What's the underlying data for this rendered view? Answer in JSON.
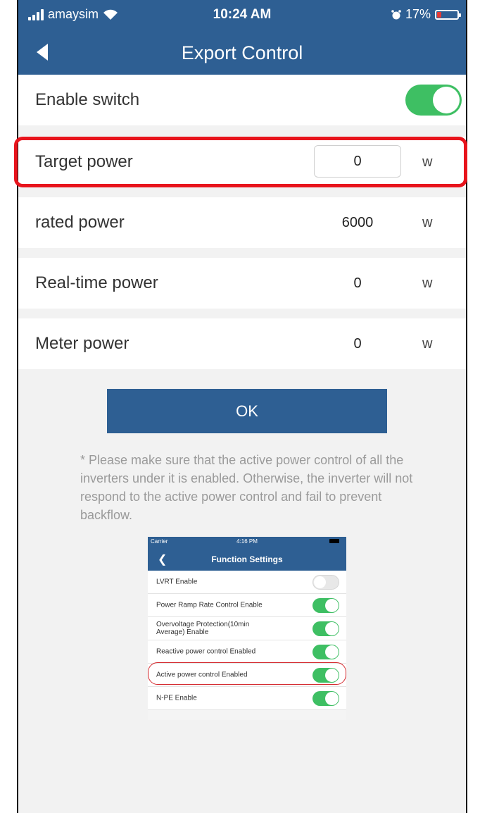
{
  "status_bar": {
    "carrier": "amaysim",
    "time": "10:24 AM",
    "battery": "17%"
  },
  "nav": {
    "title": "Export Control"
  },
  "rows": {
    "enable_switch": {
      "label": "Enable switch",
      "enabled": true
    },
    "target_power": {
      "label": "Target power",
      "value": "0",
      "unit": "w"
    },
    "rated_power": {
      "label": "rated power",
      "value": "6000",
      "unit": "w"
    },
    "realtime_power": {
      "label": "Real-time power",
      "value": "0",
      "unit": "w"
    },
    "meter_power": {
      "label": "Meter power",
      "value": "0",
      "unit": "w"
    }
  },
  "ok_button": {
    "label": "OK"
  },
  "note": "* Please make sure that the active power control of all the inverters under it is enabled. Otherwise, the inverter will not respond to the active power control and fail to prevent backflow.",
  "inset": {
    "status_bar": {
      "carrier": "Carrier",
      "time": "4:16 PM"
    },
    "title": "Function Settings",
    "items": [
      {
        "label": "LVRT Enable",
        "enabled": false
      },
      {
        "label": "Power Ramp Rate Control Enable",
        "enabled": true
      },
      {
        "label": "Overvoltage Protection(10min Average) Enable",
        "enabled": true
      },
      {
        "label": "Reactive power control Enabled",
        "enabled": true
      },
      {
        "label": "Active power control Enabled",
        "enabled": true
      },
      {
        "label": "N-PE Enable",
        "enabled": true
      }
    ]
  },
  "colors": {
    "header": "#2e5f93",
    "toggle_on": "#3ebf63",
    "highlight": "#e8141c",
    "battery_low": "#e53935"
  }
}
